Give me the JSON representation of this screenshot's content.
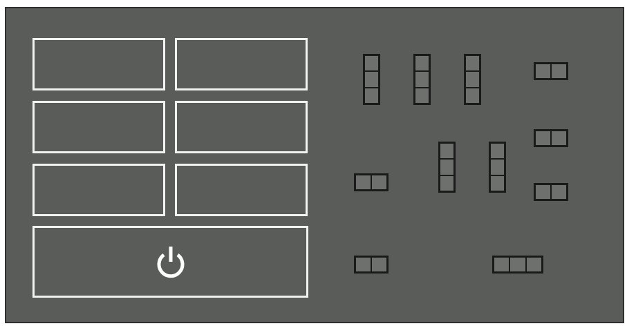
{
  "keypad": {
    "keys": [
      {
        "id": "key-1",
        "label": ""
      },
      {
        "id": "key-2",
        "label": ""
      },
      {
        "id": "key-3",
        "label": ""
      },
      {
        "id": "key-4",
        "label": ""
      },
      {
        "id": "key-5",
        "label": ""
      },
      {
        "id": "key-6",
        "label": ""
      }
    ],
    "power": {
      "icon": "power-icon"
    }
  },
  "colors": {
    "panel": "#5a5c5a",
    "key_border": "#f2f2f2",
    "slot_border": "#1a1a1a",
    "slot_fill": "#6e706e"
  },
  "slots": [
    {
      "orientation": "vertical",
      "cells": 3
    },
    {
      "orientation": "vertical",
      "cells": 3
    },
    {
      "orientation": "vertical",
      "cells": 3
    },
    {
      "orientation": "horizontal",
      "cells": 2
    },
    {
      "orientation": "horizontal",
      "cells": 2
    },
    {
      "orientation": "vertical",
      "cells": 3
    },
    {
      "orientation": "vertical",
      "cells": 3
    },
    {
      "orientation": "horizontal",
      "cells": 2
    },
    {
      "orientation": "horizontal",
      "cells": 2
    },
    {
      "orientation": "horizontal",
      "cells": 2
    },
    {
      "orientation": "horizontal",
      "cells": 3
    }
  ]
}
